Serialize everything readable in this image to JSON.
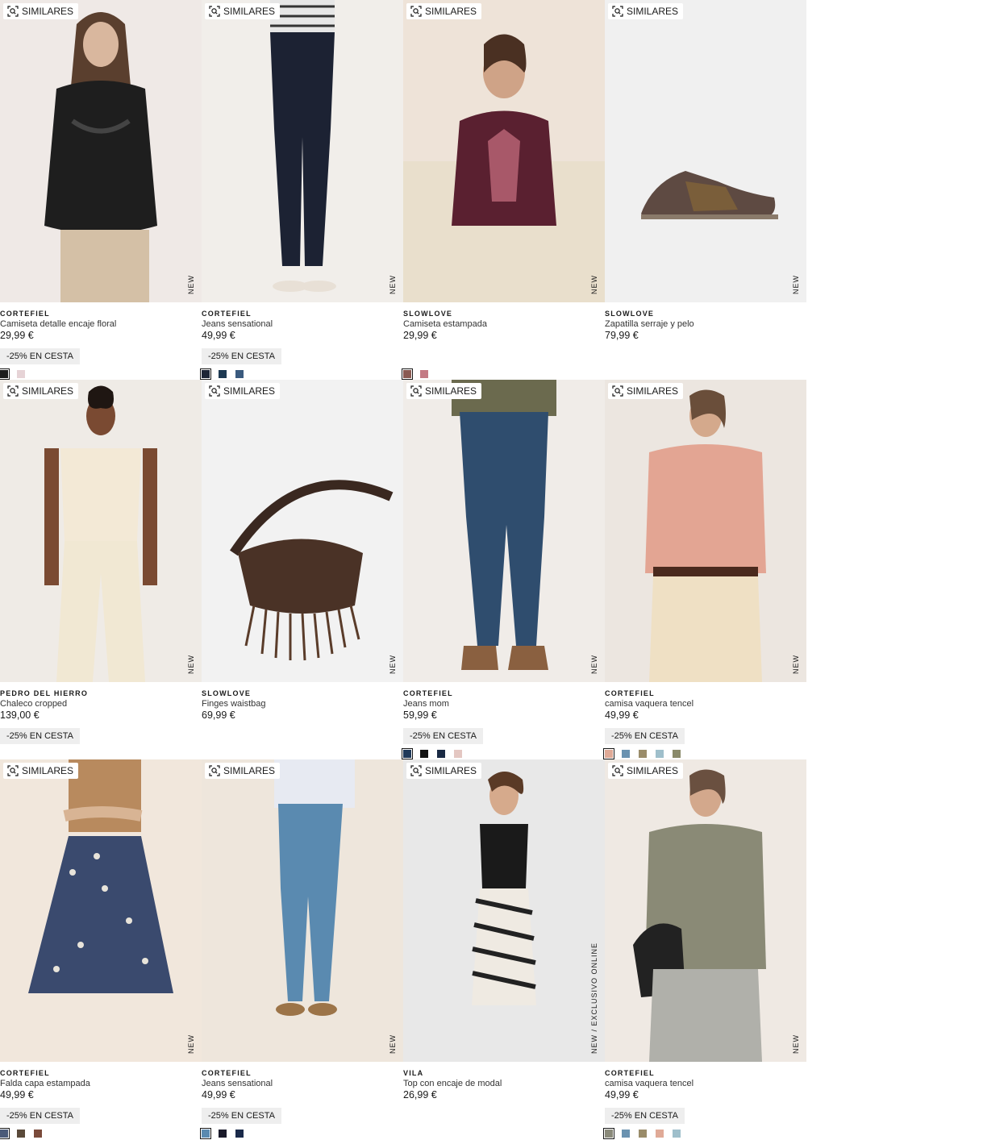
{
  "labels": {
    "similar": "SIMILARES",
    "new": "NEW",
    "new_exclusive": "NEW  /  EXCLUSIVO ONLINE"
  },
  "products": [
    {
      "brand": "CORTEFIEL",
      "name": "Camiseta detalle encaje floral",
      "price": "29,99 €",
      "promo": "-25% EN CESTA",
      "tag": "NEW",
      "swatches": [
        "#1c1c1c",
        "#e6d3d6"
      ]
    },
    {
      "brand": "CORTEFIEL",
      "name": "Jeans sensational",
      "price": "49,99 €",
      "promo": "-25% EN CESTA",
      "tag": "NEW",
      "swatches": [
        "#1d2536",
        "#1e3a52",
        "#3a5a7e"
      ]
    },
    {
      "brand": "SLOWLOVE",
      "name": "Camiseta estampada",
      "price": "29,99 €",
      "promo": "",
      "tag": "NEW",
      "swatches": [
        "#8a5a52",
        "#c37a84"
      ]
    },
    {
      "brand": "SLOWLOVE",
      "name": "Zapatilla serraje y pelo",
      "price": "79,99 €",
      "promo": "",
      "tag": "NEW",
      "swatches": []
    },
    {
      "brand": "PEDRO DEL HIERRO",
      "name": "Chaleco cropped",
      "price": "139,00 €",
      "promo": "-25% EN CESTA",
      "tag": "NEW",
      "swatches": []
    },
    {
      "brand": "SLOWLOVE",
      "name": "Finges waistbag",
      "price": "69,99 €",
      "promo": "",
      "tag": "NEW",
      "swatches": []
    },
    {
      "brand": "CORTEFIEL",
      "name": "Jeans mom",
      "price": "59,99 €",
      "promo": "-25% EN CESTA",
      "tag": "NEW",
      "swatches": [
        "#203a5a",
        "#111111",
        "#1a2a44",
        "#e4c7c2"
      ]
    },
    {
      "brand": "CORTEFIEL",
      "name": "camisa vaquera tencel",
      "price": "49,99 €",
      "promo": "-25% EN CESTA",
      "tag": "NEW",
      "swatches": [
        "#e0aa97",
        "#6a92b0",
        "#9a8c6a",
        "#9fbfcb",
        "#8a8a6a"
      ]
    },
    {
      "brand": "CORTEFIEL",
      "name": "Falda capa estampada",
      "price": "49,99 €",
      "promo": "-25% EN CESTA",
      "tag": "NEW",
      "swatches": [
        "#4a5a78",
        "#5a4a3a",
        "#7a4a3a"
      ]
    },
    {
      "brand": "CORTEFIEL",
      "name": "Jeans sensational",
      "price": "49,99 €",
      "promo": "-25% EN CESTA",
      "tag": "NEW",
      "swatches": [
        "#5a8ab0",
        "#1a1a2a",
        "#1a2a4a"
      ]
    },
    {
      "brand": "VILA",
      "name": "Top con encaje de modal",
      "price": "26,99 €",
      "promo": "",
      "tag": "NEW  /  EXCLUSIVO ONLINE",
      "swatches": []
    },
    {
      "brand": "CORTEFIEL",
      "name": "camisa vaquera tencel",
      "price": "49,99 €",
      "promo": "-25% EN CESTA",
      "tag": "NEW",
      "swatches": [
        "#8a8a7a",
        "#6a92b0",
        "#9a8c6a",
        "#e0aa97",
        "#9fbfcb"
      ]
    }
  ]
}
